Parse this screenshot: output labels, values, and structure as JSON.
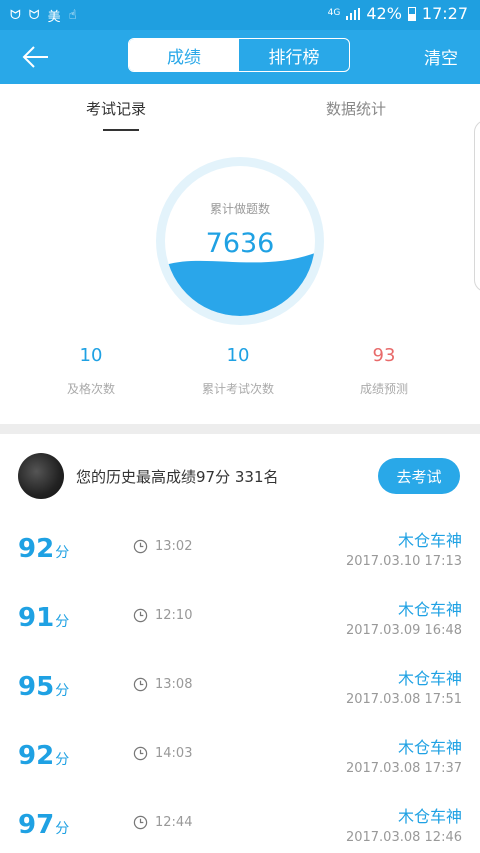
{
  "status_bar": {
    "icons": [
      "cat-icon",
      "cat-icon",
      "mei-icon",
      "hand-icon"
    ],
    "mei": "美",
    "network": "4G",
    "battery": "42%",
    "time": "17:27"
  },
  "header": {
    "tab_scores": "成绩",
    "tab_ranking": "排行榜",
    "clear": "清空"
  },
  "tabs": {
    "records": "考试记录",
    "stats": "数据统计"
  },
  "summary": {
    "title": "累计做题数",
    "total": "7636",
    "fill_level": 0.38
  },
  "stats": [
    {
      "value": "10",
      "label": "及格次数"
    },
    {
      "value": "10",
      "label": "累计考试次数"
    },
    {
      "value": "93",
      "label": "成绩预测"
    }
  ],
  "history": {
    "text": "您的历史最高成绩97分  331名",
    "button": "去考试"
  },
  "records": [
    {
      "score": "92",
      "unit": "分",
      "duration": "13:02",
      "name": "木仓车神",
      "date": "2017.03.10  17:13"
    },
    {
      "score": "91",
      "unit": "分",
      "duration": "12:10",
      "name": "木仓车神",
      "date": "2017.03.09  16:48"
    },
    {
      "score": "95",
      "unit": "分",
      "duration": "13:08",
      "name": "木仓车神",
      "date": "2017.03.08  17:51"
    },
    {
      "score": "92",
      "unit": "分",
      "duration": "14:03",
      "name": "木仓车神",
      "date": "2017.03.08  17:37"
    },
    {
      "score": "97",
      "unit": "分",
      "duration": "12:44",
      "name": "木仓车神",
      "date": "2017.03.08  12:46"
    }
  ],
  "colors": {
    "primary": "#29a8e8",
    "accent_red": "#e86a6a"
  }
}
